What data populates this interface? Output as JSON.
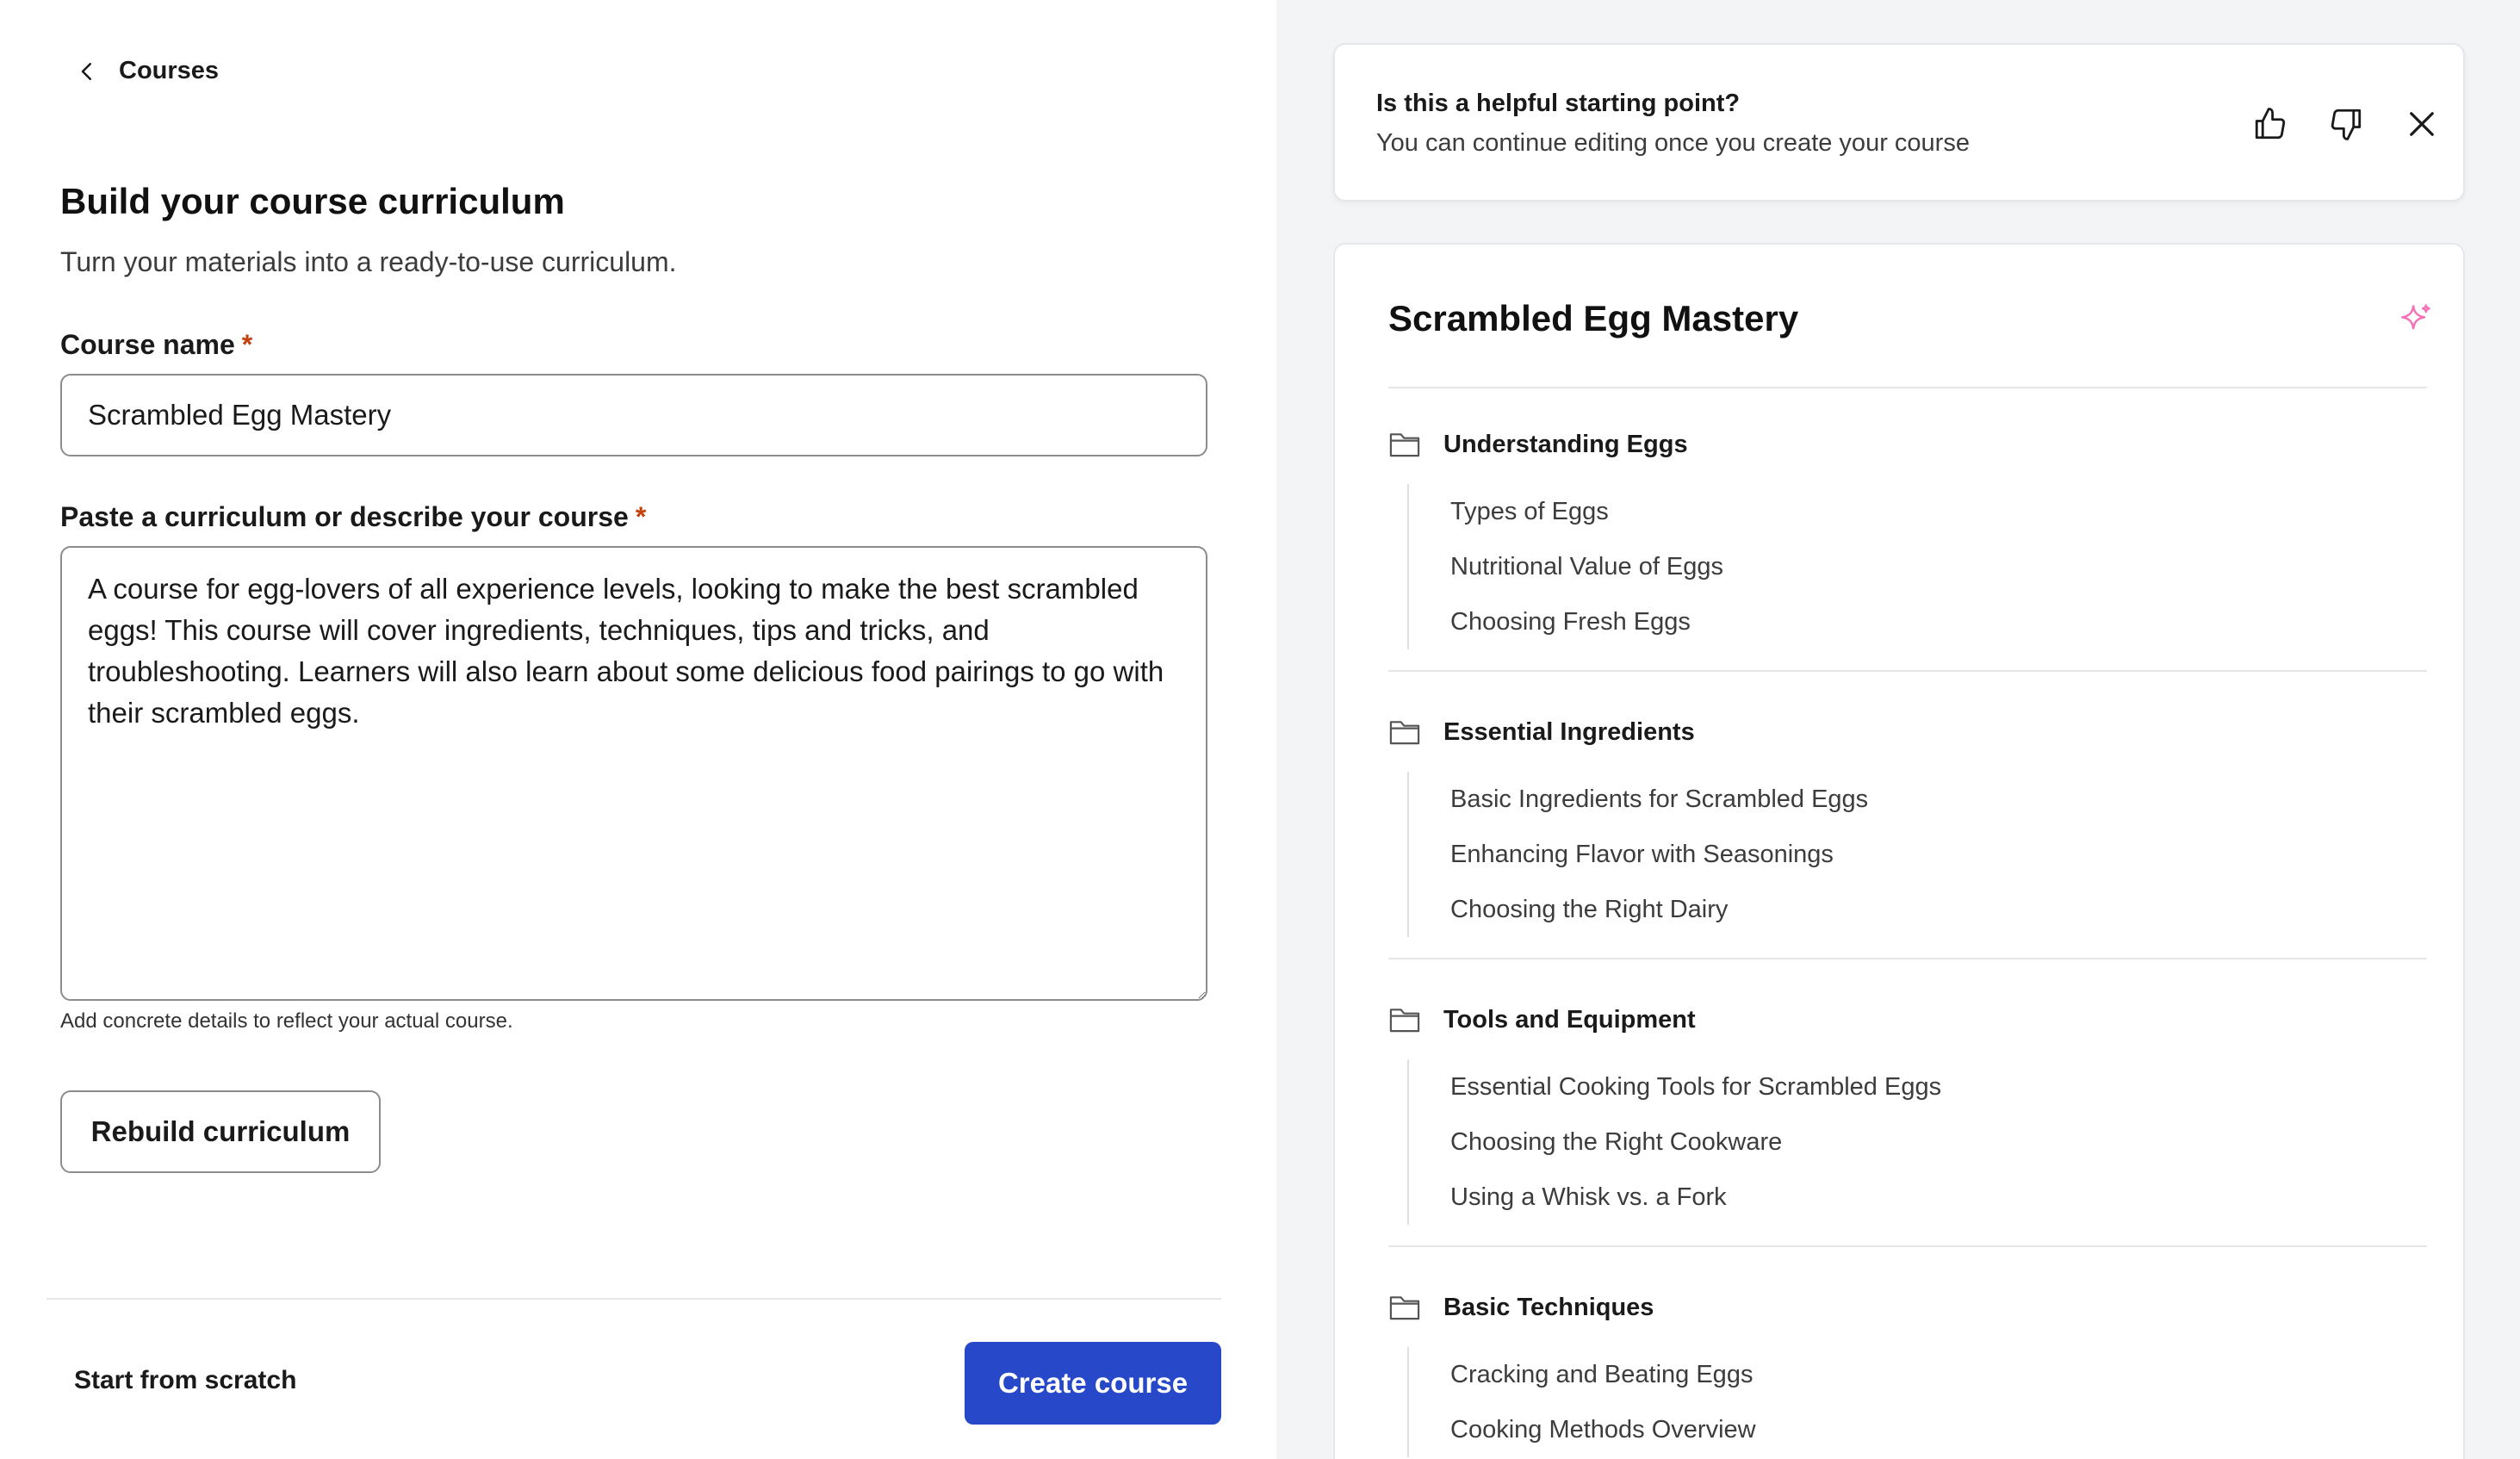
{
  "nav": {
    "back_label": "Courses"
  },
  "form": {
    "title": "Build your course curriculum",
    "subtitle": "Turn your materials into a ready-to-use curriculum.",
    "required_mark": "*",
    "name_label": "Course name",
    "name_value": "Scrambled Egg Mastery",
    "desc_label": "Paste a curriculum or describe your course",
    "desc_value": "A course for egg-lovers of all experience levels, looking to make the best scrambled eggs! This course will cover ingredients, techniques, tips and tricks, and troubleshooting. Learners will also learn about some delicious food pairings to go with their scrambled eggs.",
    "hint": "Add concrete details to reflect your actual course.",
    "rebuild_label": "Rebuild curriculum"
  },
  "footer": {
    "scratch_label": "Start from scratch",
    "create_label": "Create course",
    "create_color": "#2748c8"
  },
  "feedback": {
    "question": "Is this a helpful starting point?",
    "subtext": "You can continue editing once you create your course",
    "icons": [
      "thumbs-up-icon",
      "thumbs-down-icon",
      "close-icon"
    ]
  },
  "outline": {
    "title": "Scrambled Egg Mastery",
    "sparkle_color": "#f472b6",
    "sections": [
      {
        "title": "Understanding Eggs",
        "lessons": [
          "Types of Eggs",
          "Nutritional Value of Eggs",
          "Choosing Fresh Eggs"
        ]
      },
      {
        "title": "Essential Ingredients",
        "lessons": [
          "Basic Ingredients for Scrambled Eggs",
          "Enhancing Flavor with Seasonings",
          "Choosing the Right Dairy"
        ]
      },
      {
        "title": "Tools and Equipment",
        "lessons": [
          "Essential Cooking Tools for Scrambled Eggs",
          "Choosing the Right Cookware",
          "Using a Whisk vs. a Fork"
        ]
      },
      {
        "title": "Basic Techniques",
        "lessons": [
          "Cracking and Beating Eggs",
          "Cooking Methods Overview"
        ]
      }
    ]
  }
}
